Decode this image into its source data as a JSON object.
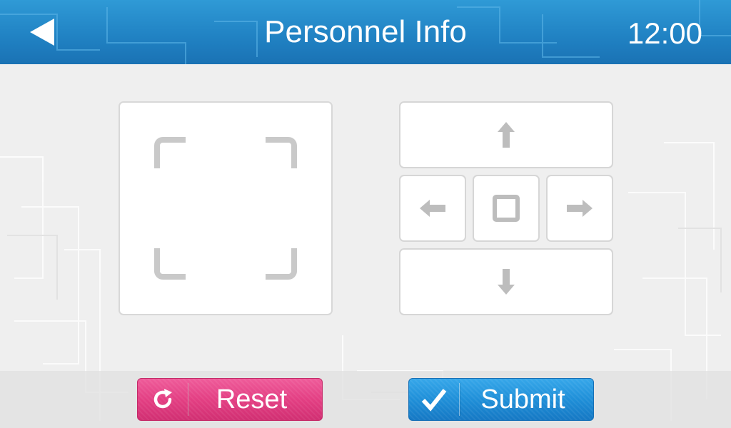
{
  "header": {
    "title": "Personnel Info",
    "time": "12:00",
    "back_icon": "back-triangle-icon"
  },
  "camera": {
    "icon": "viewfinder-corners-icon"
  },
  "dpad": {
    "up_icon": "arrow-up-icon",
    "left_icon": "arrow-left-icon",
    "center_icon": "square-stop-icon",
    "right_icon": "arrow-right-icon",
    "down_icon": "arrow-down-icon"
  },
  "actions": {
    "reset_label": "Reset",
    "reset_icon": "refresh-icon",
    "submit_label": "Submit",
    "submit_icon": "checkmark-icon"
  },
  "colors": {
    "header_blue": "#2183c4",
    "reset_pink": "#e33f83",
    "submit_blue": "#1f8fd8",
    "icon_gray": "#bdbdbd"
  }
}
